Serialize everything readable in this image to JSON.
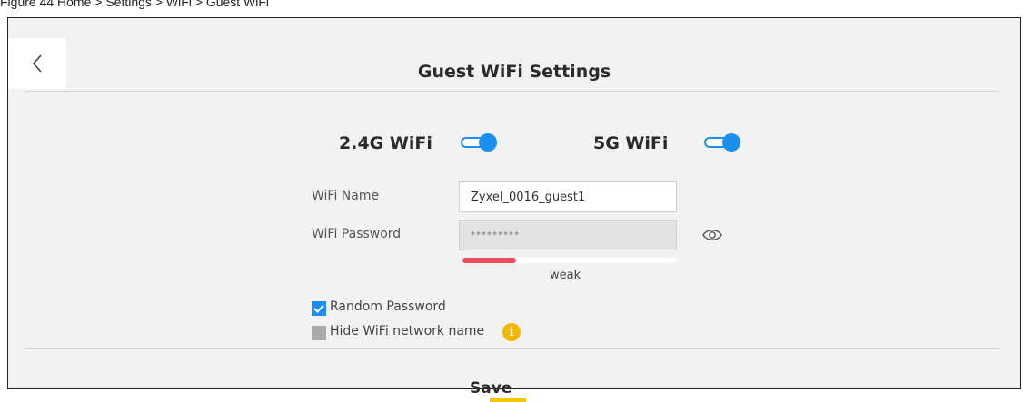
{
  "caption": "Figure 44 Home > Settings > WiFi > Guest WiFi",
  "header": {
    "title": "Guest WiFi Settings"
  },
  "bands": [
    {
      "label": "2.4G WiFi",
      "enabled": true
    },
    {
      "label": "5G WiFi",
      "enabled": true
    }
  ],
  "form": {
    "wifi_name_label": "WiFi Name",
    "wifi_name_value": "Zyxel_0016_guest1",
    "wifi_password_label": "WiFi Password",
    "wifi_password_value": "*********",
    "strength_text": "weak",
    "strength_fraction": 0.25,
    "random_password_label": "Random Password",
    "random_password_checked": true,
    "hide_ssid_label": "Hide WiFi network name",
    "hide_ssid_checked": false
  },
  "footer": {
    "save_label": "Save"
  },
  "colors": {
    "accent": "#1b8ff0",
    "weak": "#e84f5b",
    "highlight": "#f5c500",
    "info": "#f5b800"
  },
  "icons": {
    "back": "chevron-left-icon",
    "eye": "eye-icon",
    "info": "info-icon",
    "check": "check-icon"
  }
}
